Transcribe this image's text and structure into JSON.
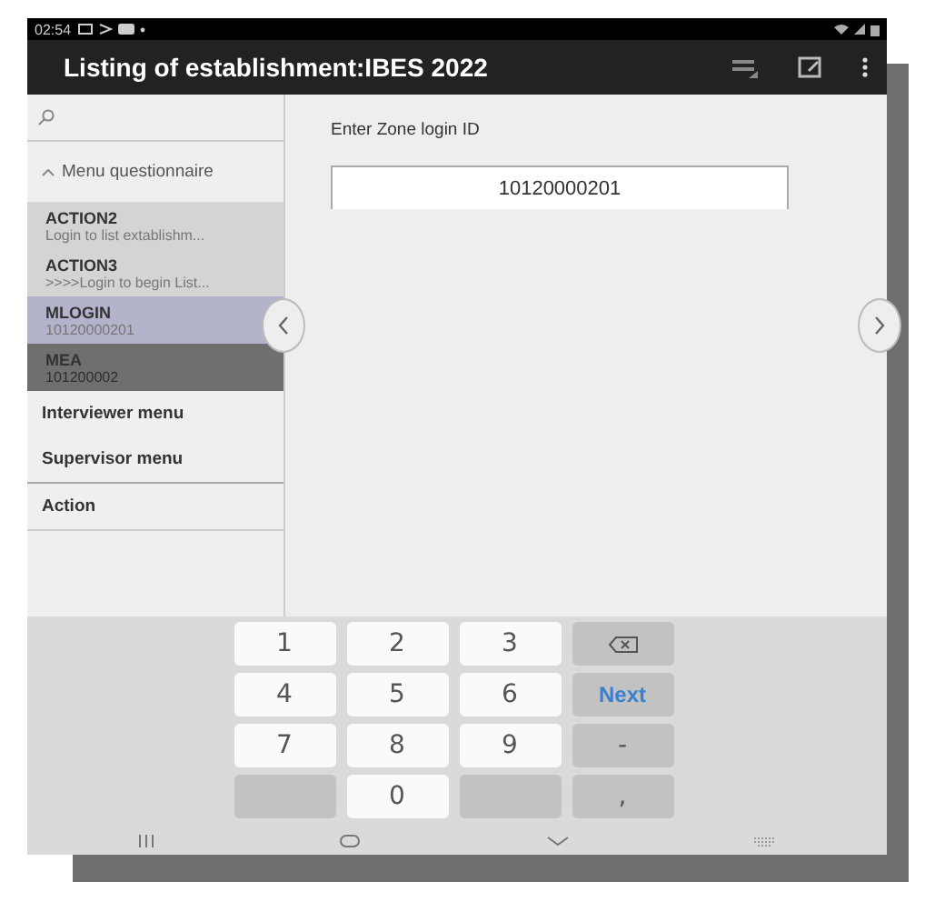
{
  "status_bar": {
    "time": "02:54"
  },
  "app_bar": {
    "title": "Listing of establishment:IBES 2022"
  },
  "sidebar": {
    "section": {
      "label": "Menu questionnaire",
      "expanded": true
    },
    "items": [
      {
        "title": "ACTION2",
        "subtitle": "Login to list extablishm...",
        "color": "#d4d4d4"
      },
      {
        "title": "ACTION3",
        "subtitle": ">>>>Login to begin List...",
        "color": "#d4d4d4"
      },
      {
        "title": "MLOGIN",
        "subtitle": "10120000201",
        "color": "#b3b3cb"
      },
      {
        "title": "MEA",
        "subtitle": "101200002",
        "color": "#6f6f6f"
      }
    ],
    "menus": [
      "Interviewer menu",
      "Supervisor menu",
      "Action"
    ]
  },
  "question": {
    "label": "Enter Zone login ID",
    "value": "10120000201"
  },
  "keyboard": {
    "keys": [
      {
        "kind": "digit",
        "label": "1"
      },
      {
        "kind": "digit",
        "label": "2"
      },
      {
        "kind": "digit",
        "label": "3"
      },
      {
        "kind": "backspace"
      },
      {
        "kind": "digit",
        "label": "4"
      },
      {
        "kind": "digit",
        "label": "5"
      },
      {
        "kind": "digit",
        "label": "6"
      },
      {
        "kind": "action",
        "label": "Next"
      },
      {
        "kind": "digit",
        "label": "7"
      },
      {
        "kind": "digit",
        "label": "8"
      },
      {
        "kind": "digit",
        "label": "9"
      },
      {
        "kind": "function",
        "label": "-"
      },
      {
        "kind": "blank"
      },
      {
        "kind": "digit",
        "label": "0"
      },
      {
        "kind": "blank"
      },
      {
        "kind": "function",
        "label": ","
      }
    ]
  }
}
